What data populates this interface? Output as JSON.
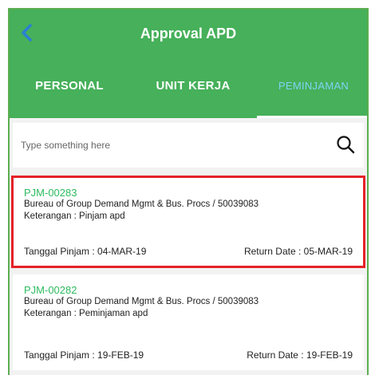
{
  "header": {
    "title": "Approval APD"
  },
  "tabs": [
    {
      "label": "PERSONAL"
    },
    {
      "label": "UNIT KERJA"
    },
    {
      "label": "PEMINJAMAN"
    }
  ],
  "search": {
    "placeholder": "Type something here"
  },
  "cards": [
    {
      "id": "PJM-00283",
      "org": "Bureau of Group Demand Mgmt & Bus. Procs / 50039083",
      "keterangan": "Keterangan : Pinjam apd",
      "tanggal": "Tanggal Pinjam : 04-MAR-19",
      "return": "Return Date : 05-MAR-19"
    },
    {
      "id": "PJM-00282",
      "org": "Bureau of Group Demand Mgmt & Bus. Procs / 50039083",
      "keterangan": "Keterangan : Peminjaman apd",
      "tanggal": "Tanggal Pinjam : 19-FEB-19",
      "return": "Return Date : 19-FEB-19"
    }
  ],
  "colors": {
    "header": "#46b05a",
    "accent_id": "#2dbb5f",
    "selection": "#e52228",
    "active_tab": "#7fd3f5"
  },
  "icons": {
    "back": "chevron-left-icon",
    "search": "search-icon"
  }
}
